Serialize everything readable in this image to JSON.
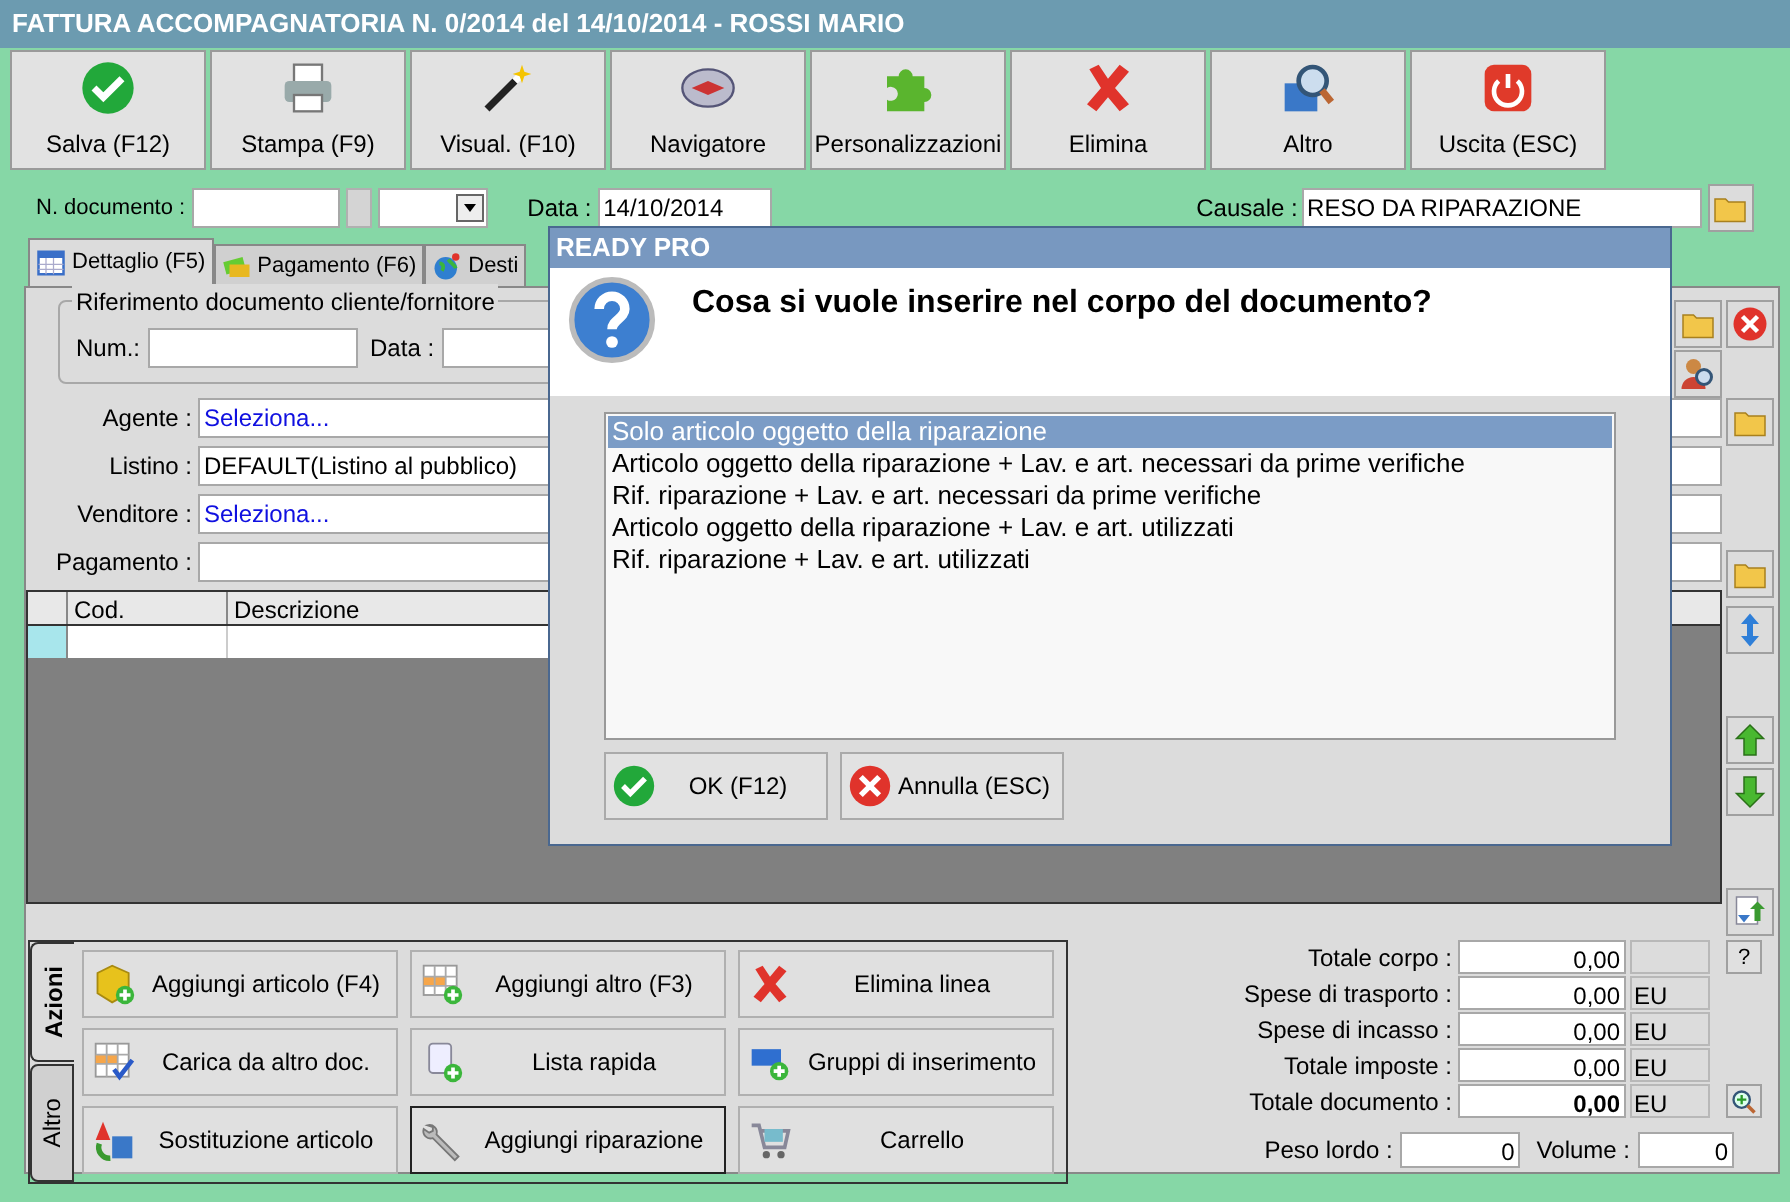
{
  "window": {
    "title": "FATTURA ACCOMPAGNATORIA N. 0/2014 del 14/10/2014 - ROSSI MARIO"
  },
  "toolbar": [
    "Salva (F12)",
    "Stampa (F9)",
    "Visual. (F10)",
    "Navigatore",
    "Personalizzazioni",
    "Elimina",
    "Altro",
    "Uscita (ESC)"
  ],
  "document": {
    "number_label": "N. documento :",
    "date_label": "Data :",
    "date_value": "14/10/2014",
    "reason_label": "Causale :",
    "reason_value": "RESO DA RIPARAZIONE"
  },
  "tabs": [
    {
      "label": "Dettaglio (F5)",
      "selected": true
    },
    {
      "label": "Pagamento (F6)",
      "selected": false
    },
    {
      "label": "Desti",
      "selected": false
    }
  ],
  "reference": {
    "legend": "Riferimento documento cliente/fornitore",
    "num_label": "Num.:",
    "date_label": "Data :"
  },
  "fields": [
    {
      "label": "Agente :",
      "value": "Seleziona...",
      "kind": "link"
    },
    {
      "label": "Listino :",
      "value": "DEFAULT(Listino al pubblico)",
      "kind": "text"
    },
    {
      "label": "Venditore :",
      "value": "Seleziona...",
      "kind": "link"
    },
    {
      "label": "Pagamento :",
      "kind": "text"
    }
  ],
  "grid": {
    "columns": [
      "Cod.",
      "Descrizione"
    ]
  },
  "actions": {
    "tabs": [
      {
        "label": "Azioni",
        "selected": true
      },
      {
        "label": "Altro",
        "selected": false
      }
    ],
    "buttons": [
      {
        "label": "Aggiungi articolo (F4)",
        "selected": false
      },
      {
        "label": "Aggiungi altro (F3)",
        "selected": false
      },
      {
        "label": "Elimina linea",
        "selected": false
      },
      {
        "label": "Carica da altro doc.",
        "selected": false
      },
      {
        "label": "Lista rapida",
        "selected": false
      },
      {
        "label": "Gruppi di inserimento",
        "selected": false
      },
      {
        "label": "Sostituzione articolo",
        "selected": false
      },
      {
        "label": "Aggiungi riparazione",
        "selected": true
      },
      {
        "label": "Carrello",
        "selected": false
      }
    ]
  },
  "totals": [
    {
      "label": "Totale corpo :",
      "value": "0,00",
      "kind": "help"
    },
    {
      "label": "Spese di trasporto :",
      "value": "0,00",
      "unit": "EU",
      "kind": "plain"
    },
    {
      "label": "Spese di incasso :",
      "value": "0,00",
      "unit": "EU",
      "kind": "plain"
    },
    {
      "label": "Totale imposte :",
      "value": "0,00",
      "unit": "EU",
      "kind": "plain"
    },
    {
      "label": "Totale documento :",
      "value": "0,00",
      "unit": "EU",
      "kind": "total"
    }
  ],
  "weight": {
    "label": "Peso lordo :",
    "value": "0"
  },
  "volume": {
    "label": "Volume :",
    "value": "0"
  },
  "help_button": "?",
  "dialog": {
    "title": "READY PRO",
    "question": "Cosa si vuole inserire nel corpo del documento?",
    "options": [
      {
        "label": "Solo articolo oggetto della riparazione",
        "selected": true
      },
      {
        "label": "Articolo oggetto della riparazione + Lav. e art. necessari da prime verifiche",
        "selected": false
      },
      {
        "label": "Rif. riparazione + Lav. e art. necessari da prime verifiche",
        "selected": false
      },
      {
        "label": "Articolo oggetto della riparazione + Lav. e art. utilizzati",
        "selected": false
      },
      {
        "label": "Rif. riparazione + Lav. e art. utilizzati",
        "selected": false
      }
    ],
    "buttons": [
      {
        "label": "OK (F12)",
        "kind": "ok"
      },
      {
        "label": "Annulla (ESC)",
        "kind": "cancel"
      }
    ]
  }
}
